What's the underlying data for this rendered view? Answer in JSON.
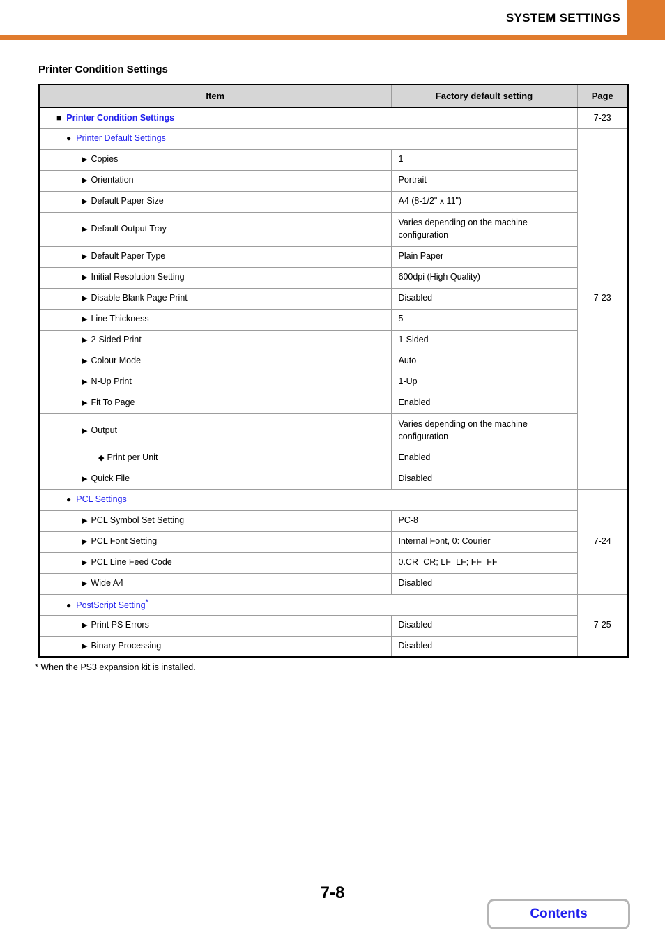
{
  "header": {
    "title": "SYSTEM SETTINGS",
    "accent_color": "#E07B2E"
  },
  "section": {
    "title": "Printer Condition Settings"
  },
  "table": {
    "columns": {
      "item": "Item",
      "factory": "Factory default setting",
      "page": "Page"
    },
    "rows": [
      {
        "kind": "group1",
        "bullet": "■",
        "item": "Printer Condition Settings",
        "page": "7-23"
      },
      {
        "kind": "group2",
        "bullet": "●",
        "item": "Printer Default Settings"
      },
      {
        "kind": "entry",
        "bullet": "▶",
        "item": "Copies",
        "value": "1"
      },
      {
        "kind": "entry",
        "bullet": "▶",
        "item": "Orientation",
        "value": "Portrait"
      },
      {
        "kind": "entry",
        "bullet": "▶",
        "item": "Default Paper Size",
        "value": "A4 (8-1/2\" x 11\")"
      },
      {
        "kind": "entry",
        "bullet": "▶",
        "item": "Default Output Tray",
        "value": "Varies depending on the machine configuration",
        "tall": true
      },
      {
        "kind": "entry",
        "bullet": "▶",
        "item": "Default Paper Type",
        "value": "Plain Paper"
      },
      {
        "kind": "entry",
        "bullet": "▶",
        "item": "Initial Resolution Setting",
        "value": "600dpi (High Quality)"
      },
      {
        "kind": "entry",
        "bullet": "▶",
        "item": "Disable Blank Page Print",
        "value": "Disabled"
      },
      {
        "kind": "entry",
        "bullet": "▶",
        "item": "Line Thickness",
        "value": "5"
      },
      {
        "kind": "entry",
        "bullet": "▶",
        "item": "2-Sided Print",
        "value": "1-Sided"
      },
      {
        "kind": "entry",
        "bullet": "▶",
        "item": "Colour Mode",
        "value": "Auto"
      },
      {
        "kind": "entry",
        "bullet": "▶",
        "item": "N-Up Print",
        "value": "1-Up"
      },
      {
        "kind": "entry",
        "bullet": "▶",
        "item": "Fit To Page",
        "value": "Enabled"
      },
      {
        "kind": "entry",
        "bullet": "▶",
        "item": "Output",
        "value": "Varies depending on the machine configuration",
        "tall": true
      },
      {
        "kind": "subentry",
        "bullet": "◆",
        "item": "Print per Unit",
        "value": "Enabled"
      },
      {
        "kind": "entry",
        "bullet": "▶",
        "item": "Quick File",
        "value": "Disabled"
      },
      {
        "kind": "group2",
        "bullet": "●",
        "item": "PCL Settings"
      },
      {
        "kind": "entry",
        "bullet": "▶",
        "item": "PCL Symbol Set Setting",
        "value": "PC-8"
      },
      {
        "kind": "entry",
        "bullet": "▶",
        "item": "PCL Font Setting",
        "value": "Internal Font, 0: Courier"
      },
      {
        "kind": "entry",
        "bullet": "▶",
        "item": "PCL Line Feed Code",
        "value": "0.CR=CR; LF=LF; FF=FF"
      },
      {
        "kind": "entry",
        "bullet": "▶",
        "item": "Wide A4",
        "value": "Disabled"
      },
      {
        "kind": "group2",
        "bullet": "●",
        "item": "PostScript Setting",
        "star": "*"
      },
      {
        "kind": "entry",
        "bullet": "▶",
        "item": "Print PS Errors",
        "value": "Disabled"
      },
      {
        "kind": "entry",
        "bullet": "▶",
        "item": "Binary Processing",
        "value": "Disabled"
      }
    ],
    "page_links": {
      "printer_condition": "7-23",
      "printer_default": "7-23",
      "pcl": "7-24",
      "postscript": "7-25"
    }
  },
  "footnote": "* When the PS3 expansion kit is installed.",
  "footer": {
    "page_number": "7-8",
    "contents_label": "Contents"
  }
}
